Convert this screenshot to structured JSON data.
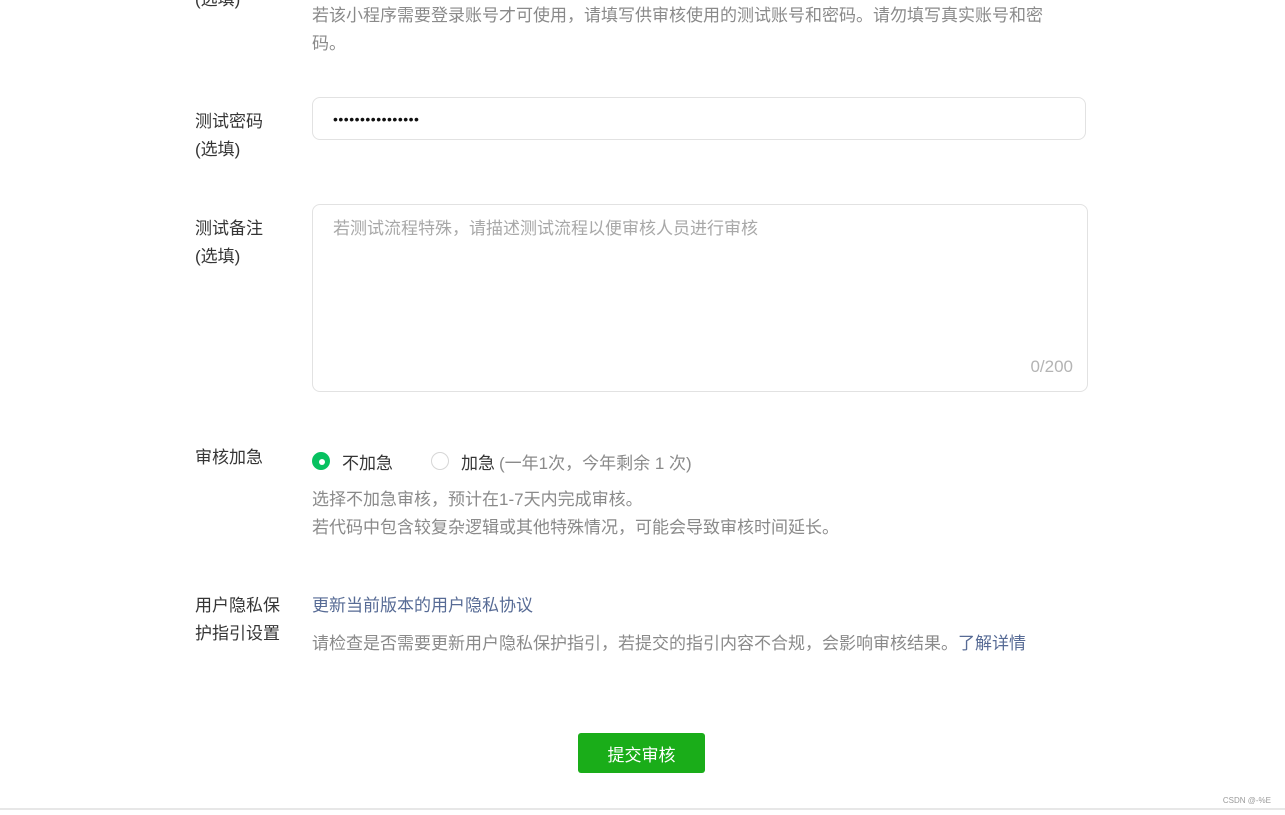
{
  "account_section": {
    "label_partial": "(选填)",
    "tip": "若该小程序需要登录账号才可使用，请填写供审核使用的测试账号和密码。请勿填写真实账号和密码。"
  },
  "password_section": {
    "label_line1": "测试密码",
    "label_line2": "(选填)",
    "value_masked": "••••••••••••••••"
  },
  "notes_section": {
    "label_line1": "测试备注",
    "label_line2": "(选填)",
    "placeholder": "若测试流程特殊，请描述测试流程以便审核人员进行审核",
    "counter": "0/200"
  },
  "urgent_section": {
    "label": "审核加急",
    "options": [
      {
        "label": "不加急",
        "checked": true
      },
      {
        "label": "加急",
        "note": "(一年1次，今年剩余 1 次)",
        "checked": false
      }
    ],
    "desc_line1": "选择不加急审核，预计在1-7天内完成审核。",
    "desc_line2": "若代码中包含较复杂逻辑或其他特殊情况，可能会导致审核时间延长。"
  },
  "privacy_section": {
    "label_line1": "用户隐私保",
    "label_line2": "护指引设置",
    "link": "更新当前版本的用户隐私协议",
    "tip": "请检查是否需要更新用户隐私保护指引，若提交的指引内容不合规，会影响审核结果。",
    "tip_link": "了解详情"
  },
  "submit_label": "提交审核",
  "watermark": "CSDN @-%E",
  "colors": {
    "primary_green": "#1aad19",
    "radio_green": "#07c160",
    "link_blue": "#576b95",
    "muted_text": "#8a8a8a"
  }
}
